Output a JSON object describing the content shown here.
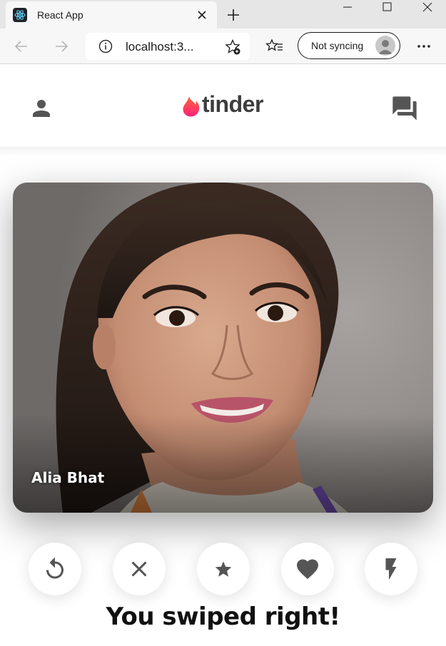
{
  "browser": {
    "tab_title": "React App",
    "url": "localhost:3...",
    "sync_label": "Not syncing"
  },
  "app": {
    "brand": "tinder",
    "brand_color": "#fd5068"
  },
  "card": {
    "name": "Alia Bhat"
  },
  "swipe_buttons": [
    {
      "icon": "replay-icon",
      "color": "#555555"
    },
    {
      "icon": "close-icon",
      "color": "#555555"
    },
    {
      "icon": "star-icon",
      "color": "#555555"
    },
    {
      "icon": "favorite-icon",
      "color": "#555555"
    },
    {
      "icon": "flash-icon",
      "color": "#555555"
    }
  ],
  "message": "You swiped right!"
}
